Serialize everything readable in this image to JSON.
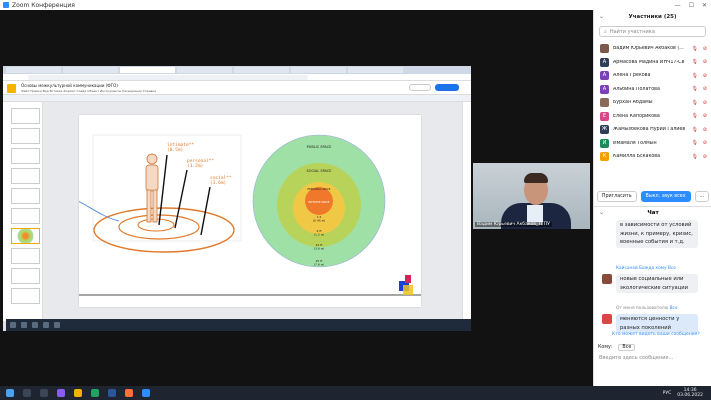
{
  "window": {
    "title": "Zoom Конференция"
  },
  "browser": {
    "tabs": [
      "",
      "",
      "",
      "",
      "",
      "",
      "",
      "",
      ""
    ],
    "doc_title": "Основы межкультурной коммуникации (ФГО)",
    "doc_menu": "Файл Правка Вид Вставка Формат Слайд Объект Инструменты Расширения Справка"
  },
  "slide": {
    "labels": {
      "intimate": "intimate**\n(0.5m)",
      "personal": "personal**\n(1.2m)",
      "social": "social**\n(3.6m)",
      "public_space": "PUBLIC SPACE",
      "social_space": "SOCIAL SPACE",
      "personal_space": "PERSONAL SPACE",
      "intimate_space": "INTIMATE SPACE",
      "d1": "1.5\n(0.45 м)",
      "d2": "4 ft\n(1.2 м)",
      "d3": "12 ft\n(3.6 м)",
      "d4": "25 ft\n(7.6 м)"
    },
    "notes": "Нажмите, чтобы добавить заметки докладчика"
  },
  "video": {
    "name": "Вадим Юрьевич Акбаков_ТГПУ"
  },
  "participants": {
    "header": "Участники (25)",
    "search_placeholder": "Найти участника",
    "list": [
      {
        "name": "Вадим Юрьевич Акбаков (...",
        "initial": "",
        "color": "#7a5a4a"
      },
      {
        "name": "Армасова Мадина ИНЧ17-Св",
        "initial": "A",
        "color": "#2f3d56"
      },
      {
        "name": "Алёна Грекова",
        "initial": "A",
        "color": "#7b3fb8"
      },
      {
        "name": "Альбина Полатова",
        "initial": "A",
        "color": "#7b3fb8"
      },
      {
        "name": "Бурхан Абдамы",
        "initial": "",
        "color": "#8a6a58"
      },
      {
        "name": "Елена Капорикова",
        "initial": "E",
        "color": "#d9478a"
      },
      {
        "name": "Жамызбекова Нурий Галиевн...",
        "initial": "Ж",
        "color": "#2f3d56"
      },
      {
        "name": "Имамаля Толмын",
        "initial": "И",
        "color": "#1e8a5a"
      },
      {
        "name": "Камилла Бскакова",
        "initial": "К",
        "color": "#f0a000"
      }
    ],
    "invite": "Пригласить",
    "mute_all": "Выкл. звук всех",
    "more": "..."
  },
  "chat": {
    "header": "Чат",
    "messages": [
      {
        "text": "в зависимости от условий жизни, к примеру, кризис, военные события и т.д."
      },
      {
        "meta_from": "Кайсанай Бажда",
        "meta_to": "кому Все",
        "text": "новые социальные или экологические ситуации"
      },
      {
        "meta_from": "От меня пользователю",
        "meta_to": "Все",
        "text": "меняются ценности у разных поколений"
      }
    ],
    "notice": "Кто может видеть ваши сообщения?",
    "to_label": "Кому:",
    "to_value": "Все",
    "placeholder": "Введите здесь сообщение..."
  },
  "taskbar": {
    "lang": "РУС",
    "time": "14:36",
    "date": "03.06.2022"
  }
}
